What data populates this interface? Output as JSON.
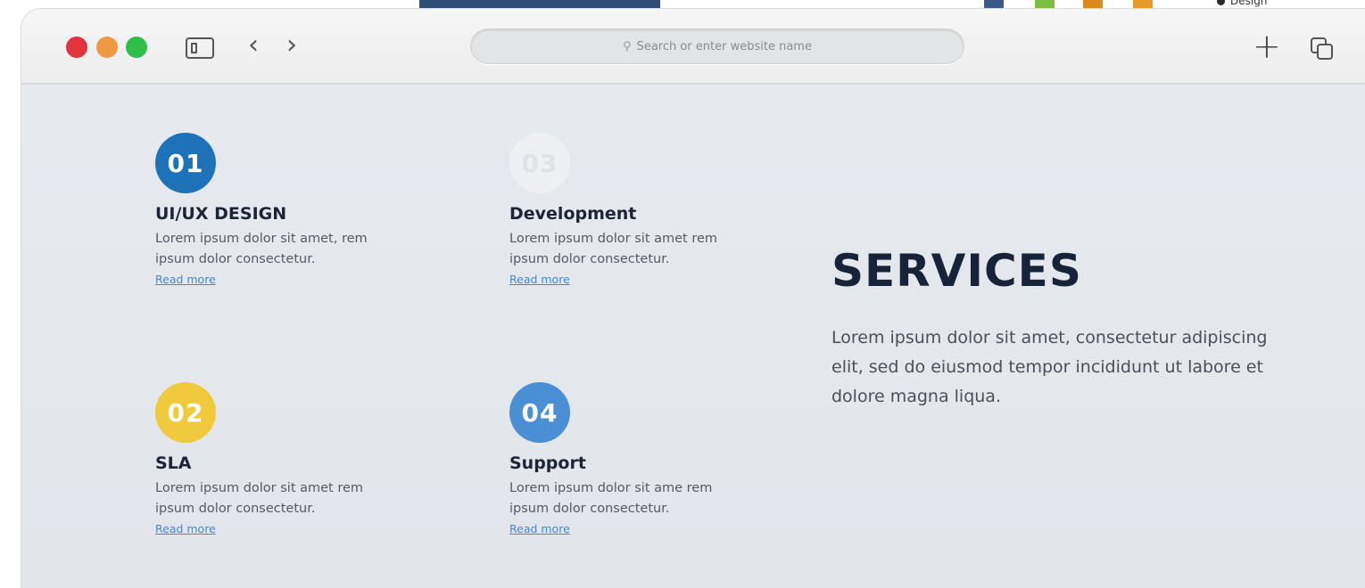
{
  "backdrop": {
    "label": "Design",
    "colors": [
      "#2f4e75",
      "#3a5a86",
      "#7bbf3f",
      "#d98a1a",
      "#e59a2a"
    ]
  },
  "browser": {
    "traffic_lights": [
      "#e3333b",
      "#ee9a45",
      "#2fbf48"
    ],
    "icons": {
      "sidebar": "sidebar-icon",
      "back": "chevron-left-icon",
      "forward": "chevron-right-icon",
      "search": "search-icon",
      "new_tab": "plus-icon",
      "tabs": "tabs-overview-icon"
    },
    "nav_back_glyph": "‹",
    "nav_forward_glyph": "›",
    "search_glyph": "⚲",
    "plus_glyph": "+",
    "address_placeholder": "Search or enter website name"
  },
  "services": {
    "heading": "SERVICES",
    "description": "Lorem ipsum dolor sit amet, consectetur adipiscing elit, sed do eiusmod tempor incididunt ut labore et  dolore magna liqua.",
    "items": [
      {
        "number": "01",
        "color": "#1e73b8",
        "title": "UI/UX DESIGN",
        "text": "Lorem ipsum dolor sit amet, rem ipsum dolor consectetur.",
        "link": "Read more"
      },
      {
        "number": "02",
        "color": "#f1c93c",
        "title": "SLA",
        "text": "Lorem ipsum dolor sit amet rem ipsum dolor consectetur.",
        "link": "Read more"
      },
      {
        "number": "03",
        "color": "#eef0f3",
        "title": "Development",
        "text": "Lorem ipsum dolor sit amet rem ipsum dolor consectetur.",
        "link": "Read more"
      },
      {
        "number": "04",
        "color": "#4a8fd4",
        "title": "Support",
        "text": "Lorem ipsum dolor sit ame rem ipsum dolor consectetur.",
        "link": "Read more"
      }
    ]
  }
}
